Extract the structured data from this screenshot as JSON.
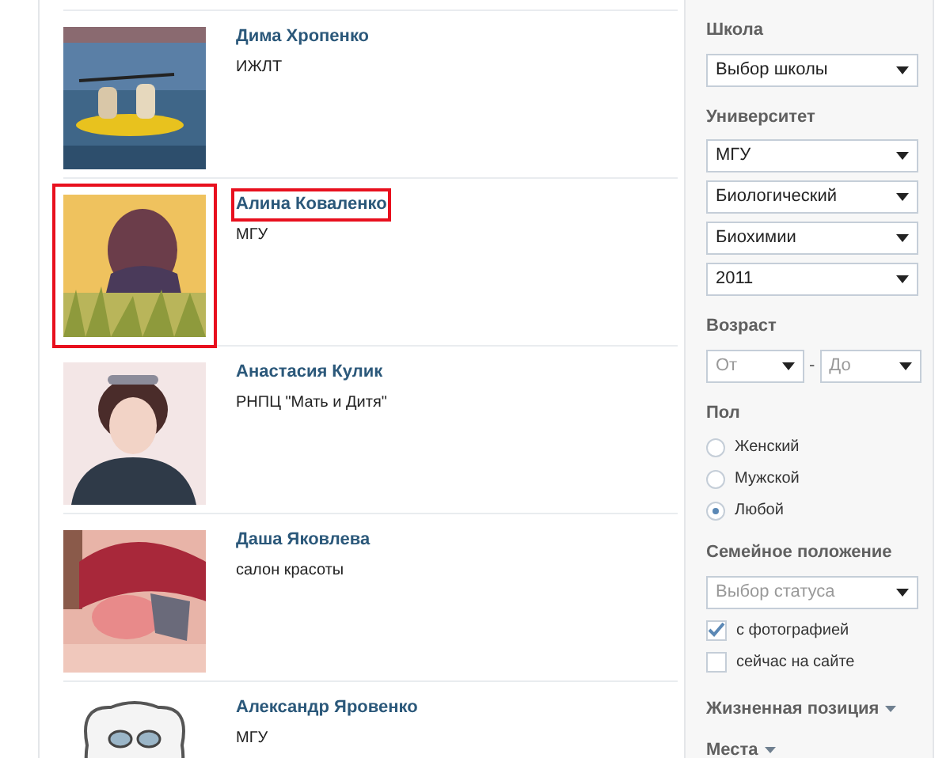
{
  "results": [
    {
      "name": "Дима Хропенко",
      "info": "ИЖЛТ",
      "highlighted": false
    },
    {
      "name": "Алина Коваленко",
      "info": "МГУ",
      "highlighted": true
    },
    {
      "name": "Анастасия Кулик",
      "info": "РНПЦ \"Мать и Дитя\"",
      "highlighted": false
    },
    {
      "name": "Даша Яковлева",
      "info": "салон красоты",
      "highlighted": false
    },
    {
      "name": "Александр Яровенко",
      "info": "МГУ",
      "highlighted": false
    }
  ],
  "filters": {
    "school": {
      "label": "Школа",
      "selects": [
        {
          "value": "Выбор школы"
        }
      ]
    },
    "university": {
      "label": "Университет",
      "selects": [
        {
          "value": "МГУ"
        },
        {
          "value": "Биологический"
        },
        {
          "value": "Биохимии"
        },
        {
          "value": "2011"
        }
      ]
    },
    "age": {
      "label": "Возраст",
      "from": {
        "placeholder": "От"
      },
      "separator": "-",
      "to": {
        "placeholder": "До"
      }
    },
    "sex": {
      "label": "Пол",
      "options": [
        {
          "label": "Женский",
          "selected": false
        },
        {
          "label": "Мужской",
          "selected": false
        },
        {
          "label": "Любой",
          "selected": true
        }
      ]
    },
    "marital": {
      "label": "Семейное положение",
      "select": {
        "placeholder": "Выбор статуса"
      }
    },
    "checkboxes": [
      {
        "label": "с фотографией",
        "checked": true
      },
      {
        "label": "сейчас на сайте",
        "checked": false
      }
    ],
    "dropdowns": [
      "Жизненная позиция",
      "Места"
    ]
  }
}
